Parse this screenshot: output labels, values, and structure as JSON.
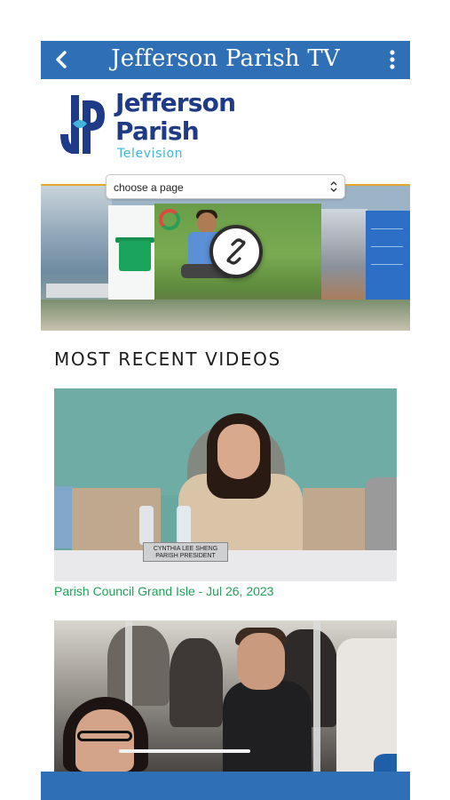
{
  "header": {
    "title": "Jefferson Parish TV",
    "back_icon": "chevron-left-icon",
    "menu_icon": "vertical-dots-icon"
  },
  "logo": {
    "line1": "Jefferson",
    "line2": "Parish",
    "line3": "Television"
  },
  "page_select": {
    "placeholder": "choose a page"
  },
  "banner": {
    "center_icon": "link-icon"
  },
  "recent_videos": {
    "heading": "MOST RECENT VIDEOS",
    "items": [
      {
        "caption": "Parish Council Grand Isle - Jul 26, 2023",
        "nameplate_name": "CYNTHIA LEE SHENG",
        "nameplate_title": "PARISH PRESIDENT"
      },
      {
        "caption": ""
      }
    ]
  },
  "colors": {
    "brand_blue": "#2f6fb6",
    "logo_navy": "#1f3b87",
    "logo_cyan": "#3fb6d8",
    "accent_gold": "#e3a92d",
    "caption_green": "#23a05a"
  }
}
